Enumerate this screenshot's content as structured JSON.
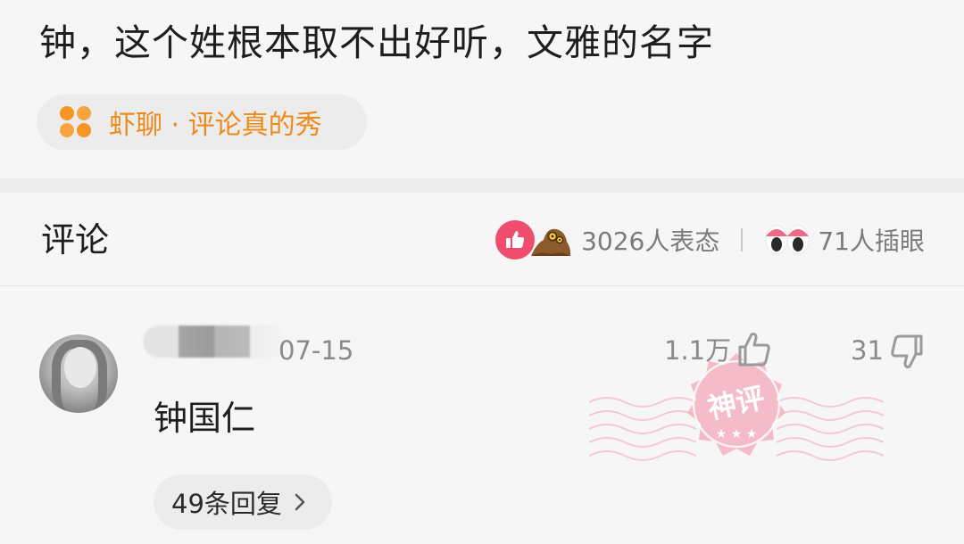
{
  "post": {
    "title": "钟，这个姓根本取不出好听，文雅的名字"
  },
  "topic": {
    "label": "虾聊 · 评论真的秀",
    "icon": "four-petal-icon",
    "color": "#f59524"
  },
  "comments_section": {
    "title": "评论",
    "reaction_count": "3026人表态",
    "eyes_count": "71人插眼"
  },
  "comment": {
    "date": "07-15",
    "likes": "1.1万",
    "dislikes": "31",
    "text": "钟国仁",
    "badge": "神评",
    "replies_label": "49条回复"
  },
  "colors": {
    "accent": "#ee8a1a",
    "like": "#f04d6e",
    "stamp": "#f2a7b8"
  }
}
